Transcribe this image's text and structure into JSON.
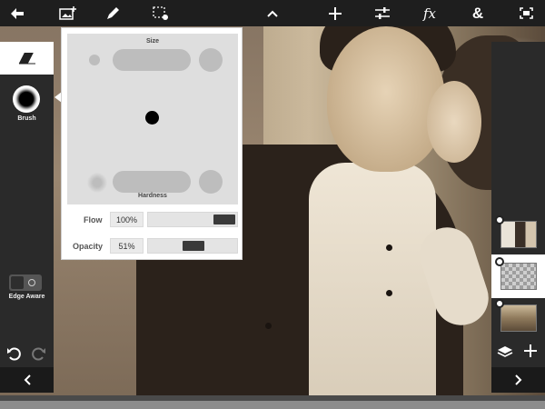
{
  "toolbar": {
    "back_icon": "back-arrow-icon",
    "items": [
      "add-image-icon",
      "brush-pen-icon",
      "selection-settings-icon",
      "collapse-chevron-up-icon",
      "add-plus-icon",
      "adjustments-sliders-icon",
      "effects-fx-icon",
      "blend-ampersand-icon",
      "fit-screen-icon"
    ],
    "fx_label": "fx",
    "amp_label": "&"
  },
  "left_panel": {
    "brush_label": "Brush",
    "edge_aware_label": "Edge Aware"
  },
  "brush_popup": {
    "size_label": "Size",
    "hardness_label": "Hardness",
    "flow_label": "Flow",
    "flow_value": "100%",
    "flow_level": 1.0,
    "opacity_label": "Opacity",
    "opacity_value": "51%",
    "opacity_level": 0.51
  },
  "layers": [
    {
      "name": "photo-layer-couple",
      "selected": false
    },
    {
      "name": "mask-layer",
      "selected": true
    },
    {
      "name": "photo-layer-city",
      "selected": false
    }
  ],
  "colors": {
    "toolbar_bg": "#1e1e1e",
    "panel_bg": "#2a2a2a",
    "popup_bg": "#ffffff",
    "accent_dark": "#3a3a3a"
  }
}
